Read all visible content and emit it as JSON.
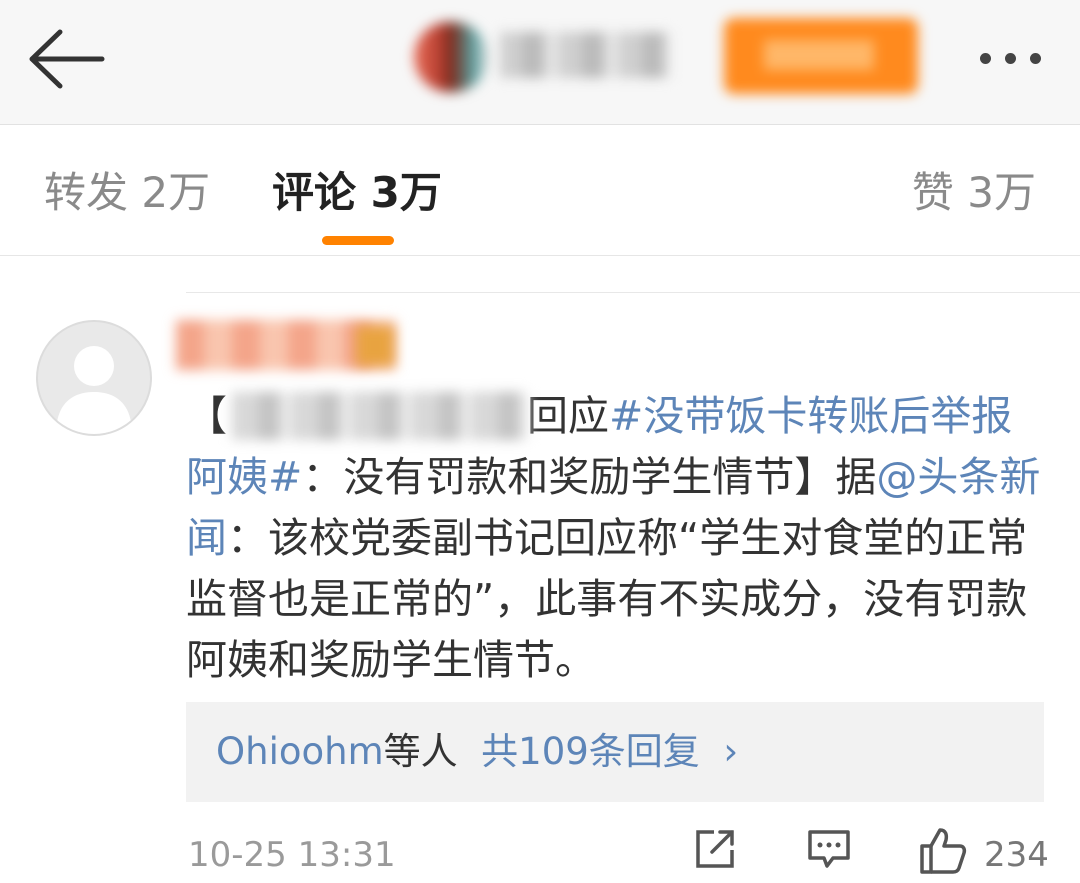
{
  "tabs": {
    "repost": "转发 2万",
    "comment": "评论 3万",
    "like": "赞 3万"
  },
  "comment": {
    "text_bracket_open": "【",
    "text_respond": "回应",
    "hashtag": "#没带饭卡转账后举报阿姨#",
    "text_part1": "：没有罚款和奖励学生情节】据",
    "mention": "@头条新闻",
    "text_part2": "：该校党委副书记回应称“学生对食堂的正常监督也是正常的”，此事有不实成分，没有罚款阿姨和奖励学生情节。"
  },
  "replies": {
    "user": "Ohioohm",
    "middle": "等人",
    "count_label": "共109条回复",
    "arrow": "›"
  },
  "footer": {
    "timestamp": "10-25 13:31",
    "like_count": "234"
  },
  "icons": {
    "back": "arrow-left-icon",
    "more": "more-dots-icon",
    "share": "share-icon",
    "reply": "comment-icon",
    "like": "thumbs-up-icon"
  },
  "colors": {
    "accent": "#ff8200",
    "link": "#5d85b8"
  }
}
